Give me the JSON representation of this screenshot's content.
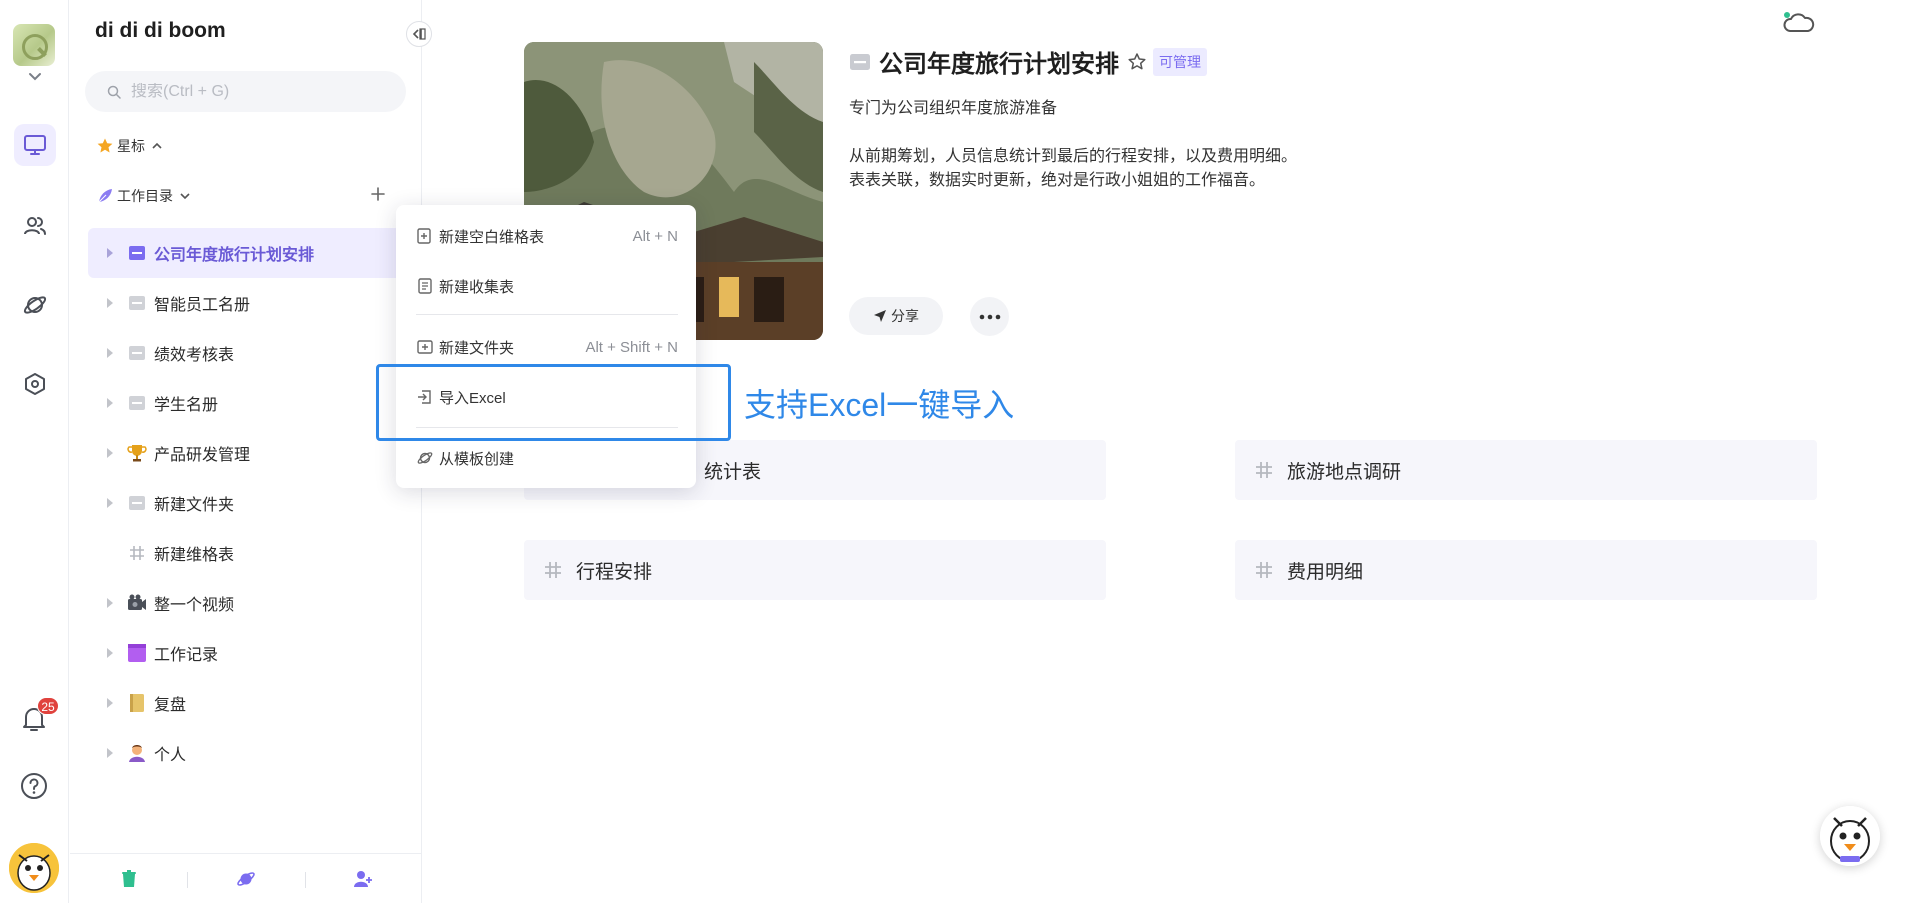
{
  "rail": {
    "notification_count": "25"
  },
  "sidebar": {
    "space_name": "di di di boom",
    "search_placeholder": "搜索(Ctrl + G)",
    "starred_label": "星标",
    "catalog_label": "工作目录",
    "items": [
      {
        "label": "公司年度旅行计划安排",
        "icon": "folder-icon"
      },
      {
        "label": "智能员工名册",
        "icon": "folder-icon"
      },
      {
        "label": "绩效考核表",
        "icon": "folder-icon"
      },
      {
        "label": "学生名册",
        "icon": "folder-icon"
      },
      {
        "label": "产品研发管理",
        "icon": "trophy-icon"
      },
      {
        "label": "新建文件夹",
        "icon": "folder-icon"
      },
      {
        "label": "新建维格表",
        "icon": "grid-icon"
      },
      {
        "label": "整一个视频",
        "icon": "camera-icon"
      },
      {
        "label": "工作记录",
        "icon": "purple-block-icon"
      },
      {
        "label": "复盘",
        "icon": "notebook-icon"
      },
      {
        "label": "个人",
        "icon": "person-icon"
      }
    ]
  },
  "menu": {
    "new_sheet": "新建空白维格表",
    "new_sheet_shortcut": "Alt + N",
    "new_form": "新建收集表",
    "new_folder": "新建文件夹",
    "new_folder_shortcut": "Alt + Shift + N",
    "import_excel": "导入Excel",
    "from_template": "从模板创建"
  },
  "folder": {
    "title": "公司年度旅行计划安排",
    "permission": "可管理",
    "desc_line1": "专门为公司组织年度旅游准备",
    "desc_line2": "从前期筹划，人员信息统计到最后的行程安排，以及费用明细。",
    "desc_line3": "表表关联，数据实时更新，绝对是行政小姐姐的工作福音。",
    "share_label": "分享"
  },
  "callout": "支持Excel一键导入",
  "cards": [
    {
      "label": "统计表"
    },
    {
      "label": "旅游地点调研"
    },
    {
      "label": "行程安排"
    },
    {
      "label": "费用明细"
    }
  ],
  "colors": {
    "accent": "#7b6cf0",
    "callout": "#2f88e8",
    "badge": "#e0423d"
  }
}
